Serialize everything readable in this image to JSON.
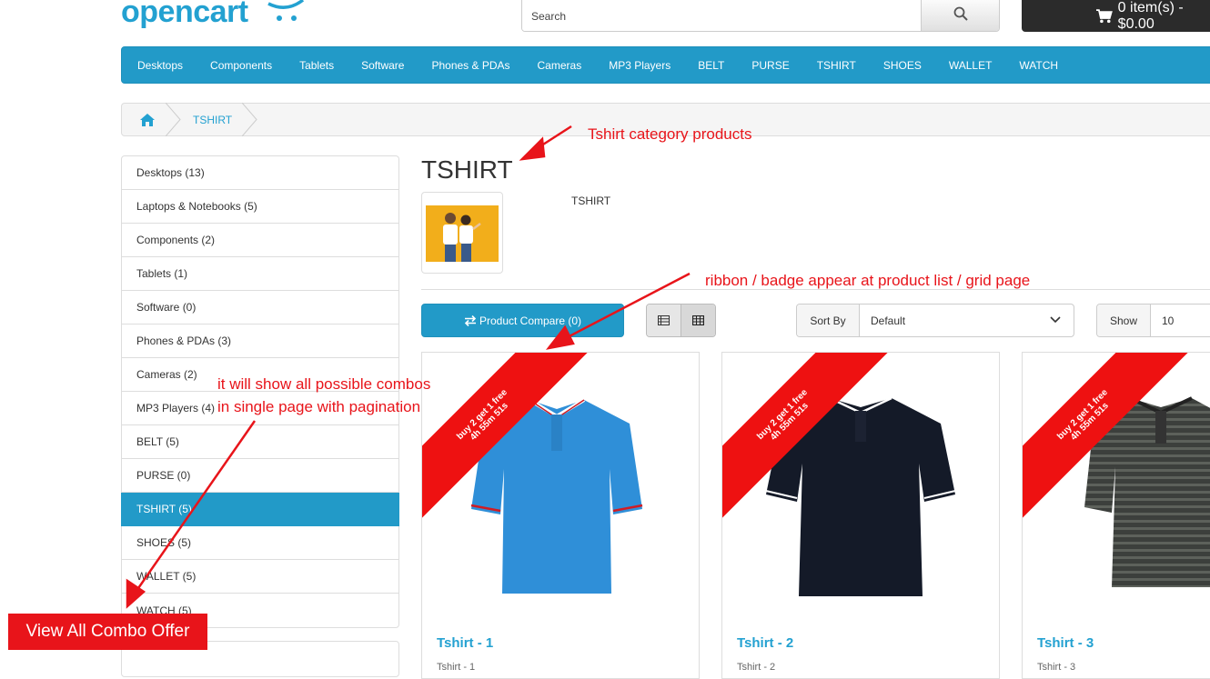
{
  "header": {
    "logo_text": "opencart",
    "search_placeholder": "Search",
    "cart_label": "0 item(s) - $0.00"
  },
  "menu": [
    "Desktops",
    "Components",
    "Tablets",
    "Software",
    "Phones & PDAs",
    "Cameras",
    "MP3 Players",
    "BELT",
    "PURSE",
    "TSHIRT",
    "SHOES",
    "WALLET",
    "WATCH"
  ],
  "breadcrumb": {
    "current": "TSHIRT"
  },
  "sidebar": {
    "items": [
      {
        "label": "Desktops (13)"
      },
      {
        "label": "Laptops & Notebooks (5)"
      },
      {
        "label": "Components (2)"
      },
      {
        "label": "Tablets (1)"
      },
      {
        "label": "Software (0)"
      },
      {
        "label": "Phones & PDAs (3)"
      },
      {
        "label": "Cameras (2)"
      },
      {
        "label": "MP3 Players (4)"
      },
      {
        "label": "BELT (5)"
      },
      {
        "label": "PURSE (0)"
      },
      {
        "label": "TSHIRT (5)",
        "active": true
      },
      {
        "label": "SHOES (5)"
      },
      {
        "label": "WALLET (5)"
      },
      {
        "label": "WATCH (5)"
      }
    ]
  },
  "category": {
    "title": "TSHIRT",
    "description": "TSHIRT"
  },
  "toolbar": {
    "compare_label": "Product Compare (0)",
    "sort_label": "Sort By",
    "sort_value": "Default",
    "show_label": "Show",
    "show_value": "10"
  },
  "products": [
    {
      "name": "Tshirt - 1",
      "desc": "Tshirt - 1",
      "ribbon_line1": "buy 2 get 1 free",
      "ribbon_line2": "4h 55m 51s",
      "color": "#2f8fd8"
    },
    {
      "name": "Tshirt - 2",
      "desc": "Tshirt - 2",
      "ribbon_line1": "buy 2 get 1 free",
      "ribbon_line2": "4h 55m 51s",
      "color": "#141a28"
    },
    {
      "name": "Tshirt - 3",
      "desc": "Tshirt - 3",
      "ribbon_line1": "buy 2 get 1 free",
      "ribbon_line2": "4h 55m 51s",
      "color": "#3c3f3c"
    }
  ],
  "annotations": {
    "category_note": "Tshirt category products",
    "ribbon_note": "ribbon / badge appear at product list / grid page",
    "combo_note_line1": "it will show all possible combos",
    "combo_note_line2": "in single page with pagination",
    "combo_button": "View All Combo Offer"
  },
  "colors": {
    "brand_blue": "#229ac8",
    "ribbon_red": "#ee1111",
    "annotation_red": "#e8141a"
  }
}
